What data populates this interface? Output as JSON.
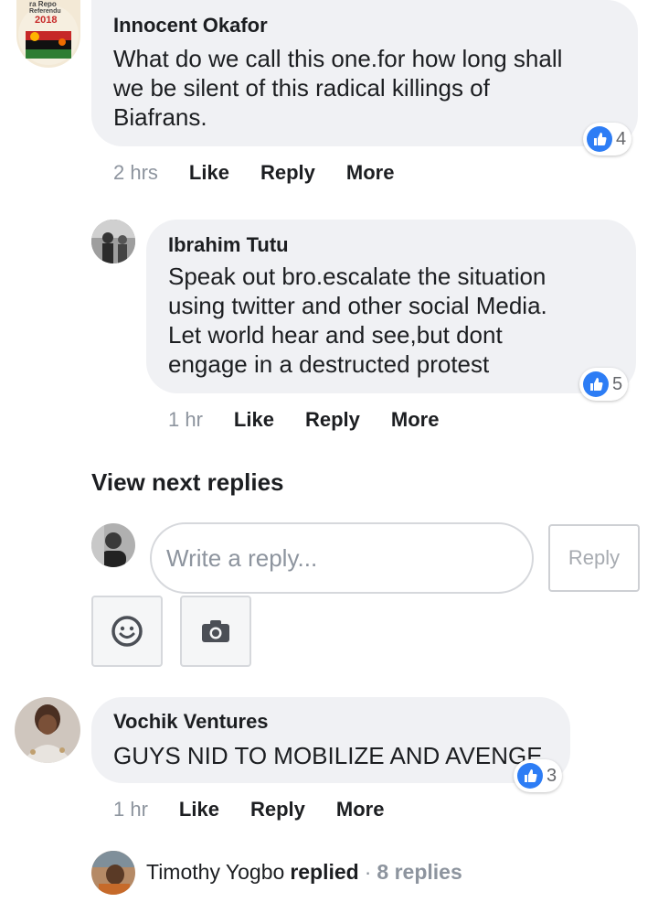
{
  "comments": [
    {
      "author": "Innocent Okafor",
      "text": "What do we call this one.for how long shall\nwe be silent of this radical killings of\nBiafrans.",
      "reactions": "4",
      "time": "2 hrs",
      "actions": [
        "Like",
        "Reply",
        "More"
      ],
      "avatar_text": [
        "ra Repo",
        "Referendu",
        "2018"
      ]
    },
    {
      "author": "Ibrahim Tutu",
      "text": "Speak out bro.escalate the situation\nusing twitter and other social Media.\nLet world hear and see,but dont\nengage in a destructed protest",
      "reactions": "5",
      "time": "1 hr",
      "actions": [
        "Like",
        "Reply",
        "More"
      ]
    },
    {
      "author": "Vochik Ventures",
      "text": "GUYS NID TO MOBILIZE AND AVENGE",
      "reactions": "3",
      "time": "1 hr",
      "actions": [
        "Like",
        "Reply",
        "More"
      ]
    }
  ],
  "view_next": "View next replies",
  "reply_box": {
    "placeholder": "Write a reply...",
    "button": "Reply"
  },
  "summary": {
    "name": "Timothy Yogbo",
    "action": "replied",
    "separator": "·",
    "count": "8 replies"
  },
  "colors": {
    "like_blue": "#2d7df5",
    "bubble": "#f0f1f4",
    "muted": "#8d949e"
  },
  "icons": [
    "thumbs-up-icon",
    "emoji-icon",
    "camera-icon"
  ]
}
